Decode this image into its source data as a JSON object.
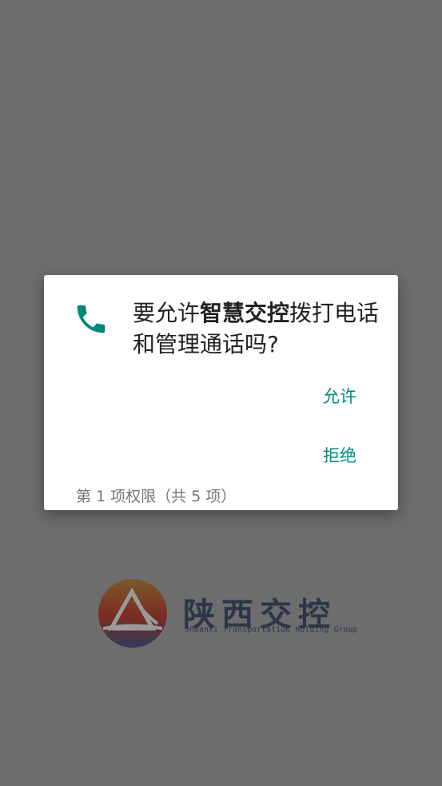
{
  "dialog": {
    "icon": "phone-icon",
    "message_prefix": "要允许",
    "app_name": "智慧交控",
    "message_suffix": "拨打电话和管理通话吗?",
    "allow_label": "允许",
    "deny_label": "拒绝",
    "counter": "第 1 项权限（共 5 项）"
  },
  "logo": {
    "title": "陕西交控",
    "subtitle": "Shaanxi Transportation Holding Group"
  },
  "colors": {
    "accent": "#00897b",
    "scrim": "#6d6d6d",
    "dialog_bg": "#ffffff"
  }
}
